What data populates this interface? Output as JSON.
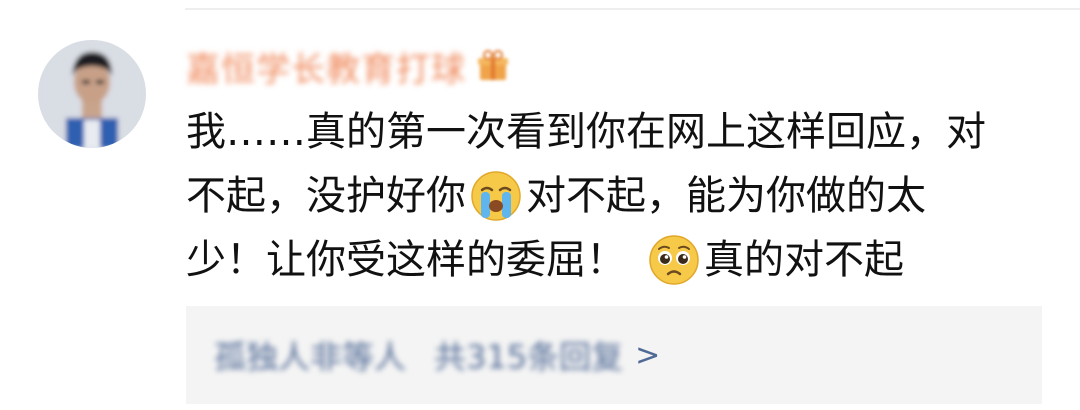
{
  "user": {
    "name": "嘉恒学长教育打球",
    "badge_icon": "gift-badge-icon"
  },
  "comment": {
    "line1": "我……真的第一次看到你在网上这样回应，对",
    "line2_a": "不起，没护好你",
    "emoji1": "crying-face-emoji",
    "line2_b": "对不起，能为你做的太",
    "line3_a": "少！让你受这样的委屈！",
    "emoji2": "pleading-face-emoji",
    "line3_b": "真的对不起"
  },
  "replies": {
    "names": "孤独人非等人",
    "count": "共315条回复",
    "chevron": ">"
  },
  "colors": {
    "username": "#f08a5d",
    "text": "#111111",
    "link": "#506a96",
    "reply_bg": "#f4f4f4"
  }
}
